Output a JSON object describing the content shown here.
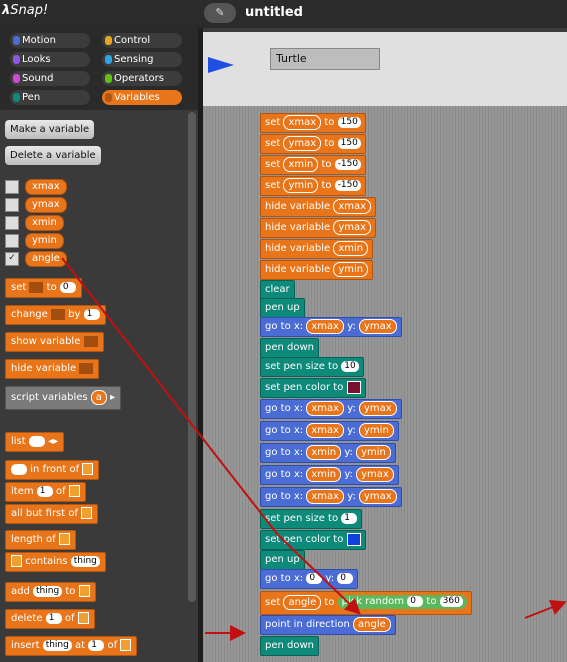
{
  "app": {
    "logo": "Snap!",
    "logo_lambda": "λ",
    "project_title": "untitled",
    "file_icon": "✎"
  },
  "categories": [
    "Motion",
    "Looks",
    "Sound",
    "Pen",
    "Control",
    "Sensing",
    "Operators",
    "Variables"
  ],
  "category_colors": {
    "Motion": "#4a6cd4",
    "Looks": "#8f56e3",
    "Sound": "#cf4ad9",
    "Pen": "#0e8a7a",
    "Control": "#e6a822",
    "Sensing": "#2ca5e2",
    "Operators": "#62c213",
    "Variables": "#e8751a"
  },
  "palette": {
    "make_variable": "Make a variable",
    "delete_variable": "Delete a variable",
    "variables": [
      "xmax",
      "ymax",
      "xmin",
      "ymin",
      "angle"
    ],
    "checked_mark": "✓",
    "set": "set",
    "to": "to",
    "set_value": "0",
    "change": "change",
    "by": "by",
    "change_value": "1",
    "show_variable": "show variable",
    "hide_variable": "hide variable",
    "script_variables": "script variables",
    "script_var": "a",
    "list": "list",
    "in_front_of": "in front of",
    "item": "item",
    "item_value": "1",
    "of": "of",
    "all_but_first_of": "all but first of",
    "length_of": "length of",
    "contains": "contains",
    "thing": "thing",
    "add": "add",
    "delete": "delete",
    "delete_value": "1",
    "insert": "insert",
    "at": "at",
    "insert_value": "1"
  },
  "stage": {
    "sprite_name": "Turtle"
  },
  "script": {
    "set": "set",
    "to": "to",
    "sets": [
      {
        "var": "xmax",
        "val": "150"
      },
      {
        "var": "ymax",
        "val": "150"
      },
      {
        "var": "xmin",
        "val": "-150"
      },
      {
        "var": "ymin",
        "val": "-150"
      }
    ],
    "hide_variable": "hide variable",
    "hides": [
      "xmax",
      "ymax",
      "xmin",
      "ymin"
    ],
    "clear": "clear",
    "pen_up": "pen up",
    "pen_down": "pen down",
    "go_to_x": "go to x:",
    "y": "y:",
    "set_pen_size_to": "set pen size to",
    "pen_size_1": "10",
    "pen_size_2": "1",
    "set_pen_color_to": "set pen color to",
    "pen_color_1": "#7a1030",
    "pen_color_2": "#1040e0",
    "gotos": [
      {
        "x": "xmax",
        "y": "ymax"
      },
      {
        "x": "xmax",
        "y": "ymin"
      },
      {
        "x": "xmin",
        "y": "ymin"
      },
      {
        "x": "xmin",
        "y": "ymax"
      },
      {
        "x": "xmax",
        "y": "ymax"
      }
    ],
    "goto_zero": {
      "x": "0",
      "y": "0"
    },
    "set_angle_var": "angle",
    "pick_random": "pick random",
    "rand_from": "0",
    "rand_to": "360",
    "point_in_direction": "point in direction",
    "point_var": "angle"
  }
}
